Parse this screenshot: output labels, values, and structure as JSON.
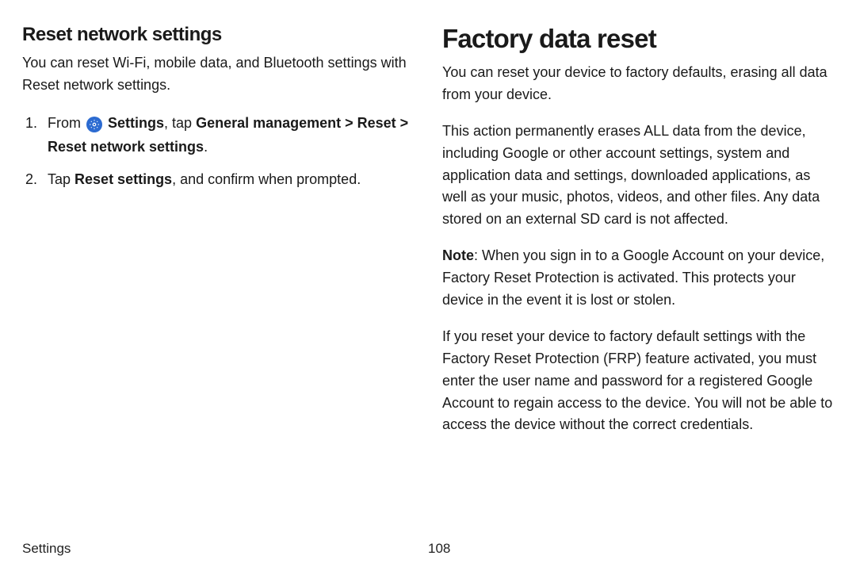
{
  "left": {
    "heading": "Reset network settings",
    "intro": "You can reset Wi-Fi, mobile data, and Bluetooth settings with Reset network settings.",
    "step1_prefix": "From ",
    "step1_settings_label": "Settings",
    "step1_mid": ", tap ",
    "step1_path": "General management > Reset > Reset network settings",
    "step1_suffix": ".",
    "step2_prefix": "Tap ",
    "step2_bold": "Reset settings",
    "step2_suffix": ", and confirm when prompted."
  },
  "right": {
    "heading": "Factory data reset",
    "p1": "You can reset your device to factory defaults, erasing all data from your device.",
    "p2": "This action permanently erases ALL data from the device, including Google or other account settings, system and application data and settings, downloaded applications, as well as your music, photos, videos, and other files. Any data stored on an external SD card is not affected.",
    "note_label": "Note",
    "note_body": ": When you sign in to a Google Account on your device, Factory Reset Protection is activated. This protects your device in the event it is lost or stolen.",
    "p3": "If you reset your device to factory default settings with the Factory Reset Protection (FRP) feature activated, you must enter the user name and password for a registered Google Account to regain access to the device. You will not be able to access the device without the correct credentials."
  },
  "footer": {
    "section": "Settings",
    "page": "108"
  }
}
